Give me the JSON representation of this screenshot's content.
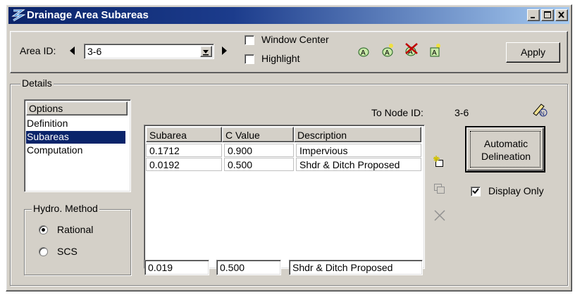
{
  "window": {
    "title": "Drainage Area Subareas"
  },
  "toolbar": {
    "area_id_label": "Area ID:",
    "area_id_value": "3-6",
    "window_center_label": "Window Center",
    "highlight_label": "Highlight",
    "apply_label": "Apply"
  },
  "details": {
    "group_label": "Details",
    "options_header": "Options",
    "options": [
      {
        "label": "Definition",
        "selected": false
      },
      {
        "label": "Subareas",
        "selected": true
      },
      {
        "label": "Computation",
        "selected": false
      }
    ],
    "to_node_label": "To Node ID:",
    "to_node_value": "3-6",
    "hydro_method_label": "Hydro. Method",
    "methods": [
      {
        "label": "Rational",
        "checked": true
      },
      {
        "label": "SCS",
        "checked": false
      }
    ],
    "table": {
      "columns": [
        "Subarea",
        "C Value",
        "Description"
      ],
      "rows": [
        [
          "0.1712",
          "0.900",
          "Impervious"
        ],
        [
          "0.0192",
          "0.500",
          "Shdr & Ditch Proposed"
        ]
      ]
    },
    "edit": {
      "subarea": "0.019",
      "c_value": "0.500",
      "description": "Shdr & Ditch Proposed"
    },
    "automatic_delineation_label": "Automatic Delineation",
    "display_only_label": "Display Only",
    "display_only_checked": true
  },
  "colors": {
    "face": "#d4d0c8",
    "title_start": "#0a246a",
    "title_end": "#a6caf0",
    "selection": "#0a246a"
  }
}
